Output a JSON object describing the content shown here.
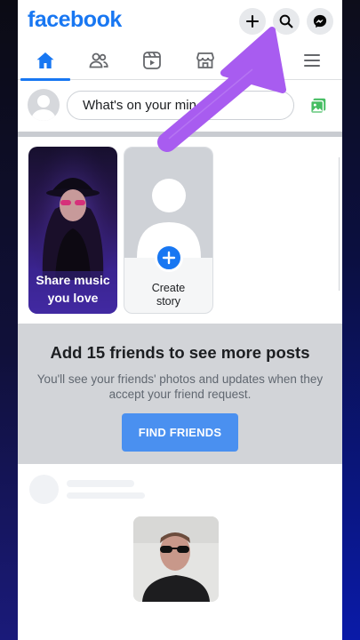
{
  "app": {
    "logo": "facebook",
    "brand_color": "#1877f2"
  },
  "header": {
    "actions": [
      {
        "icon": "plus-icon"
      },
      {
        "icon": "search-icon"
      },
      {
        "icon": "messenger-icon"
      }
    ]
  },
  "nav": {
    "tabs": [
      {
        "icon": "home-icon",
        "active": true
      },
      {
        "icon": "friends-icon",
        "active": false
      },
      {
        "icon": "watch-icon",
        "active": false
      },
      {
        "icon": "marketplace-icon",
        "active": false
      },
      {
        "icon": "notifications-icon",
        "active": false
      },
      {
        "icon": "menu-icon",
        "active": false
      }
    ]
  },
  "composer": {
    "placeholder": "What's on your mind?",
    "visible_text": "What's on your min"
  },
  "stories": {
    "music_line1": "Share music",
    "music_line2": "you love",
    "create_line1": "Create",
    "create_line2": "story"
  },
  "friends_prompt": {
    "title": "Add 15 friends to see more posts",
    "line1": "You'll see your friends' photos and updates when they",
    "line2": "accept your friend request.",
    "button": "FIND FRIENDS"
  },
  "annotation": {
    "arrow_color": "#a85cf0"
  }
}
